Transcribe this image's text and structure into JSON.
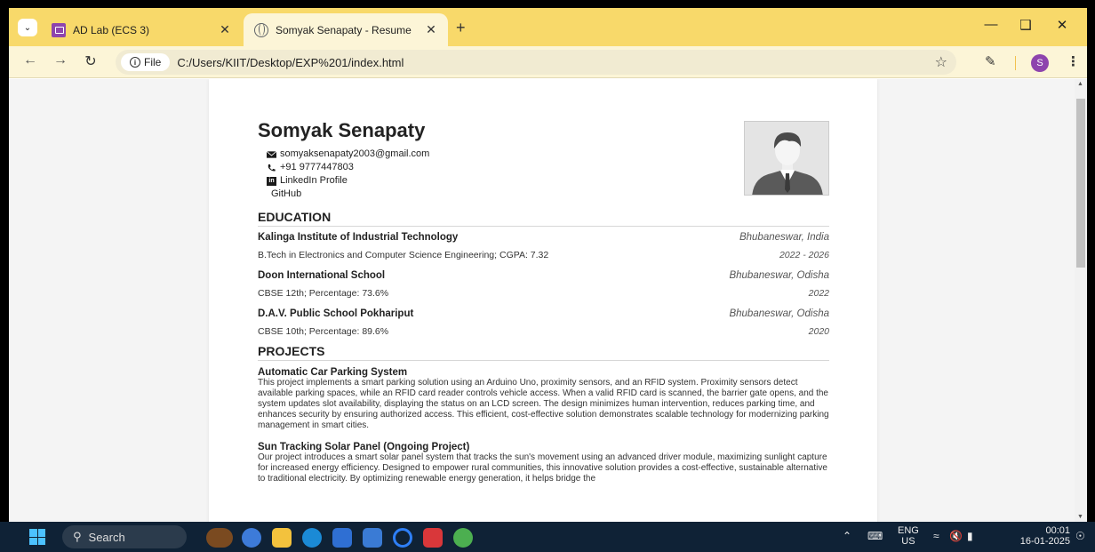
{
  "browser": {
    "tabs": [
      {
        "title": "AD Lab (ECS 3)",
        "active": false
      },
      {
        "title": "Somyak Senapaty - Resume",
        "active": true
      }
    ],
    "address": {
      "scheme_label": "File",
      "url": "C:/Users/KIIT/Desktop/EXP%201/index.html"
    },
    "profile_initial": "S"
  },
  "resume": {
    "name": "Somyak Senapaty",
    "contact": {
      "email": "somyaksenapaty2003@gmail.com",
      "phone": "+91 9777447803",
      "linkedin": "LinkedIn Profile",
      "github": "GitHub"
    },
    "education_heading": "EDUCATION",
    "education": [
      {
        "institution": "Kalinga Institute of Industrial Technology",
        "location": "Bhubaneswar, India",
        "degree": "B.Tech in Electronics and Computer Science Engineering; CGPA: 7.32",
        "year": "2022 - 2026"
      },
      {
        "institution": "Doon International School",
        "location": "Bhubaneswar, Odisha",
        "degree": "CBSE 12th; Percentage: 73.6%",
        "year": "2022"
      },
      {
        "institution": "D.A.V. Public School Pokhariput",
        "location": "Bhubaneswar, Odisha",
        "degree": "CBSE 10th; Percentage: 89.6%",
        "year": "2020"
      }
    ],
    "projects_heading": "PROJECTS",
    "projects": [
      {
        "title": "Automatic Car Parking System",
        "description": "This project implements a smart parking solution using an Arduino Uno, proximity sensors, and an RFID system. Proximity sensors detect available parking spaces, while an RFID card reader controls vehicle access. When a valid RFID card is scanned, the barrier gate opens, and the system updates slot availability, displaying the status on an LCD screen. The design minimizes human intervention, reduces parking time, and enhances security by ensuring authorized access. This efficient, cost-effective solution demonstrates scalable technology for modernizing parking management in smart cities."
      },
      {
        "title": "Sun Tracking Solar Panel (Ongoing Project)",
        "description": "Our project introduces a smart solar panel system that tracks the sun's movement using an advanced driver module, maximizing sunlight capture for increased energy efficiency. Designed to empower rural communities, this innovative solution provides a cost-effective, sustainable alternative to traditional electricity. By optimizing renewable energy generation, it helps bridge the"
      }
    ]
  },
  "taskbar": {
    "search_placeholder": "Search",
    "language": "ENG",
    "region": "US",
    "time": "00:01",
    "date": "16-01-2025"
  }
}
